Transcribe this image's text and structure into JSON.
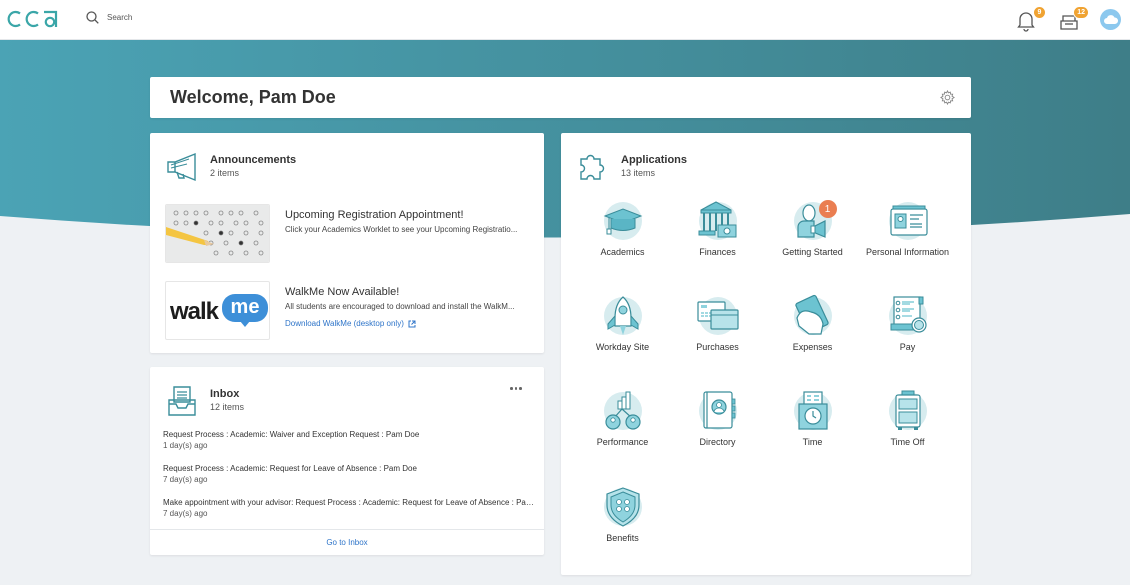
{
  "topbar": {
    "logo_text": "cca",
    "search_placeholder": "Search",
    "notifications_count": "9",
    "inbox_count": "12"
  },
  "colors": {
    "brand_teal": "#3a8d9a",
    "banner_left": "#4ba3b5",
    "banner_right": "#3e7e88",
    "link": "#2f75c9",
    "badge_orange": "#f0a332",
    "app_badge": "#ea7e51"
  },
  "welcome": {
    "title": "Welcome, Pam Doe"
  },
  "announcements": {
    "title": "Announcements",
    "count": "2 items",
    "items": [
      {
        "title": "Upcoming Registration Appointment!",
        "description": "Click your Academics Worklet to see your Upcoming Registratio...",
        "thumbnail": "test-answer-sheet-with-pencil"
      },
      {
        "title": "WalkMe Now Available!",
        "description": "All students are encouraged to download and install the WalkM...",
        "link": "Download WalkMe (desktop only)",
        "thumbnail": "walkme-logo",
        "logo_text_a": "walk",
        "logo_text_b": "me"
      }
    ]
  },
  "inbox": {
    "title": "Inbox",
    "count": "12 items",
    "items": [
      {
        "title": "Request Process : Academic: Waiver and Exception Request : Pam Doe",
        "time": "1 day(s) ago"
      },
      {
        "title": "Request Process : Academic: Request for Leave of Absence : Pam Doe",
        "time": "7 day(s) ago"
      },
      {
        "title": "Make appointment with your advisor: Request Process : Academic: Request for Leave of Absence : Pam Doe",
        "time": "7 day(s) ago"
      }
    ],
    "footer_link": "Go to Inbox"
  },
  "applications": {
    "title": "Applications",
    "count": "13 items",
    "items": [
      {
        "label": "Academics",
        "icon": "graduation-cap-icon"
      },
      {
        "label": "Finances",
        "icon": "bank-icon"
      },
      {
        "label": "Getting Started",
        "icon": "person-megaphone-icon",
        "badge": "1"
      },
      {
        "label": "Personal Information",
        "icon": "id-card-icon"
      },
      {
        "label": "Workday Site",
        "icon": "rocket-icon"
      },
      {
        "label": "Purchases",
        "icon": "credit-cards-icon"
      },
      {
        "label": "Expenses",
        "icon": "hand-money-icon"
      },
      {
        "label": "Pay",
        "icon": "pay-slip-icon"
      },
      {
        "label": "Performance",
        "icon": "performance-chart-icon"
      },
      {
        "label": "Directory",
        "icon": "address-book-icon"
      },
      {
        "label": "Time",
        "icon": "time-clock-icon"
      },
      {
        "label": "Time Off",
        "icon": "suitcase-icon"
      },
      {
        "label": "Benefits",
        "icon": "shield-icon"
      }
    ]
  }
}
